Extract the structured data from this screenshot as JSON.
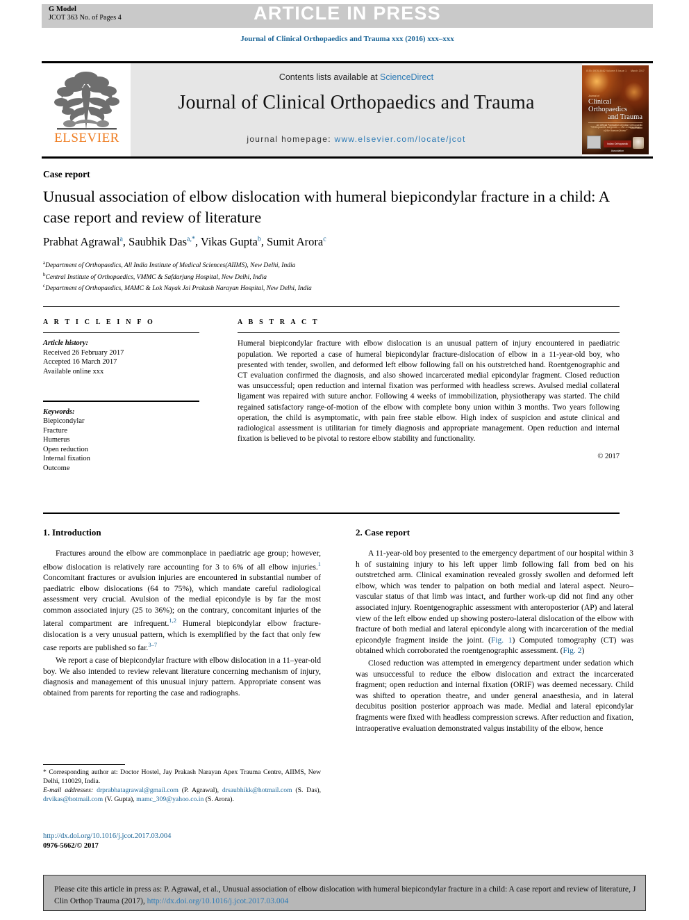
{
  "banner": {
    "g_model": "G Model",
    "g_model_sub": "JCOT 363 No. of Pages 4",
    "article_in_press": "ARTICLE IN PRESS"
  },
  "journal_ref": "Journal of Clinical Orthopaedics and Trauma xxx (2016) xxx–xxx",
  "masthead": {
    "contents_prefix": "Contents lists available at ",
    "contents_link": "ScienceDirect",
    "journal_title": "Journal of Clinical Orthopaedics and Trauma",
    "homepage_label": "journal homepage: ",
    "homepage_url": "www.elsevier.com/locate/jcot",
    "publisher": "ELSEVIER",
    "cover": {
      "top_left": "ISSN 0976-5662 Volume 8 Issue 1",
      "top_right": "March 2017",
      "pre_title": "Journal of",
      "title_line1": "Clinical Orthopaedics",
      "title_line2": "and Trauma",
      "subtitle": "An Official Publication of Indian Orthopaedic Association",
      "quote": "\"Orthopaedic surgeons — the conservators of the human frame\"",
      "badge_mid": "Indian Orthopaedic Association"
    }
  },
  "article": {
    "section_label": "Case report",
    "title": "Unusual association of elbow dislocation with humeral biepicondylar fracture in a child: A case report and review of literature",
    "authors": [
      {
        "name": "Prabhat Agrawal",
        "marks": "a"
      },
      {
        "name": "Saubhik Das",
        "marks": "a,*"
      },
      {
        "name": "Vikas Gupta",
        "marks": "b"
      },
      {
        "name": "Sumit Arora",
        "marks": "c"
      }
    ],
    "affiliations": [
      {
        "mark": "a",
        "text": "Department of Orthopaedics, All India Institute of Medical Sciences(AIIMS), New Delhi, India"
      },
      {
        "mark": "b",
        "text": "Central Institute of Orthopaedics, VMMC & Safdarjung Hospital, New Delhi, India"
      },
      {
        "mark": "c",
        "text": "Department of Orthopaedics, MAMC & Lok Nayak Jai Prakash Narayan Hospital, New Delhi, India"
      }
    ]
  },
  "article_info": {
    "heading": "A R T I C L E   I N F O",
    "history_label": "Article history:",
    "history": [
      "Received 26 February 2017",
      "Accepted 16 March 2017",
      "Available online xxx"
    ],
    "keywords_label": "Keywords:",
    "keywords": [
      "Biepicondylar",
      "Fracture",
      "Humerus",
      "Open reduction",
      "Internal fixation",
      "Outcome"
    ]
  },
  "abstract": {
    "heading": "A B S T R A C T",
    "text": "Humeral biepicondylar fracture with elbow dislocation is an unusual pattern of injury encountered in paediatric population. We reported a case of humeral biepicondylar fracture-dislocation of elbow in a 11-year-old boy, who presented with tender, swollen, and deformed left elbow following fall on his outstretched hand. Roentgenographic and CT evaluation confirmed the diagnosis, and also showed incarcerated medial epicondylar fragment. Closed reduction was unsuccessful; open reduction and internal fixation was performed with headless screws. Avulsed medial collateral ligament was repaired with suture anchor. Following 4 weeks of immobilization, physiotherapy was started. The child regained satisfactory range-of-motion of the elbow with complete bony union within 3 months. Two years following operation, the child is asymptomatic, with pain free stable elbow. High index of suspicion and astute clinical and radiological assessment is utilitarian for timely diagnosis and appropriate management. Open reduction and internal fixation is believed to be pivotal to restore elbow stability and functionality.",
    "copyright": "© 2017"
  },
  "sections": {
    "introduction": {
      "heading": "1. Introduction",
      "paragraphs": [
        {
          "parts": [
            {
              "t": "Fractures around the elbow are commonplace in paediatric age group; however, elbow dislocation is relatively rare accounting for 3 to 6% of all elbow injuries."
            },
            {
              "t": "1",
              "style": "ref"
            },
            {
              "t": " Concomitant fractures or avulsion injuries are encountered in substantial number of paediatric elbow dislocations (64 to 75%), which mandate careful radiological assessment very crucial. Avulsion of the medial epicondyle is by far the most common associated injury (25 to 36%); on the contrary, concomitant injuries of the lateral compartment are infrequent."
            },
            {
              "t": "1,2",
              "style": "ref"
            },
            {
              "t": " Humeral biepicondylar elbow fracture-dislocation is a very unusual pattern, which is exemplified by the fact that only few case reports are published so far."
            },
            {
              "t": "3–7",
              "style": "ref"
            }
          ]
        },
        {
          "parts": [
            {
              "t": "We report a case of biepicondylar fracture with elbow dislocation in a 11–year-old boy. We also intended to review relevant literature concerning mechanism of injury, diagnosis and management of this unusual injury pattern. Appropriate consent was obtained from parents for reporting the case and radiographs."
            }
          ]
        }
      ]
    },
    "case_report": {
      "heading": "2. Case report",
      "paragraphs": [
        {
          "parts": [
            {
              "t": "A 11-year-old boy presented to the emergency department of our hospital within 3 h of sustaining injury to his left upper limb following fall from bed on his outstretched arm. Clinical examination revealed grossly swollen and deformed left elbow, which was tender to palpation on both medial and lateral aspect. Neuro–vascular status of that limb was intact, and further work-up did not find any other associated injury. Roentgenographic assessment with anteroposterior (AP) and lateral view of the left elbow ended up showing postero-lateral dislocation of the elbow with fracture of both medial and lateral epicondyle along with incarceration of the medial epicondyle fragment inside the joint. ("
            },
            {
              "t": "Fig. 1",
              "style": "figlink"
            },
            {
              "t": ") Computed tomography (CT) was obtained which corroborated the roentgenographic assessment. ("
            },
            {
              "t": "Fig. 2",
              "style": "figlink"
            },
            {
              "t": ")"
            }
          ]
        },
        {
          "parts": [
            {
              "t": "Closed reduction was attempted in emergency department under sedation which was unsuccessful to reduce the elbow dislocation and extract the incarcerated fragment; open reduction and internal fixation (ORIF) was deemed necessary. Child was shifted to operation theatre, and under general anaesthesia, and in lateral decubitus position posterior approach was made. Medial and lateral epicondylar fragments were fixed with headless compression screws. After reduction and fixation, intraoperative evaluation demonstrated valgus instability of the elbow, hence"
            }
          ]
        }
      ]
    }
  },
  "footnotes": {
    "corresponding": "* Corresponding author at: Doctor Hostel, Jay Prakash Narayan Apex Trauma Centre, AIIMS, New Delhi, 110029, India.",
    "email_label": "E-mail addresses:",
    "emails": [
      {
        "address": "drprabhatagrawal@gmail.com",
        "owner": " (P. Agrawal), "
      },
      {
        "address": "drsaubhikk@hotmail.com",
        "owner": " (S. Das), "
      },
      {
        "address": "drvikas@hotmail.com",
        "owner": " (V. Gupta), "
      },
      {
        "address": "mamc_309@yahoo.co.in",
        "owner": " (S. Arora)."
      }
    ],
    "doi": "http://dx.doi.org/10.1016/j.jcot.2017.03.004",
    "issn": "0976-5662/© 2017"
  },
  "cite_box": {
    "text_before": "Please cite this article in press as: P. Agrawal, et al., Unusual association of elbow dislocation with humeral biepicondylar fracture in a child: A case report and review of literature, J Clin Orthop Trauma (2017), ",
    "link": "http://dx.doi.org/10.1016/j.jcot.2017.03.004"
  },
  "colors": {
    "link_blue": "#1a6496",
    "elsevier_orange": "#ef7d22",
    "banner_gray": "#c9c9c9",
    "masthead_gray": "#e6e6e6",
    "cite_gray": "#b7b7b7"
  }
}
